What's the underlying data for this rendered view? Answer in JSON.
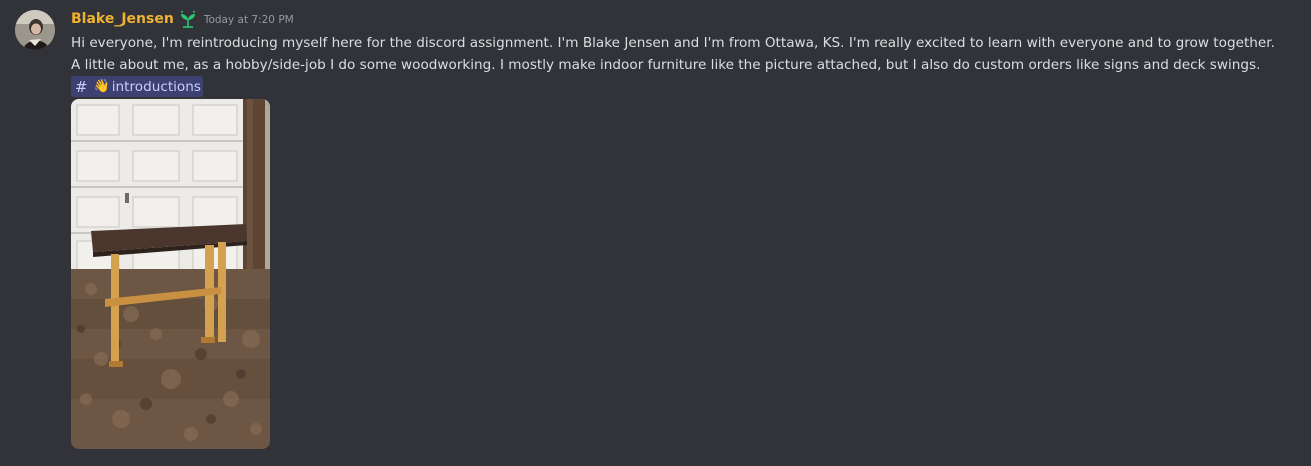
{
  "message": {
    "author": "Blake_Jensen",
    "timestamp": "Today at 7:20 PM",
    "lines": [
      "Hi everyone, I'm reintroducing myself here for the discord assignment. I'm Blake Jensen and I'm from Ottawa, KS. I'm really excited to learn with everyone and to grow together.",
      "A little about me, as a hobby/side-job I do some woodworking. I mostly make indoor furniture like the picture attached, but I also do custom orders like signs and deck swings."
    ],
    "channel_mention": {
      "prefix": "#",
      "emoji": "👋",
      "name": "introductions"
    }
  },
  "colors": {
    "background": "#313338",
    "username": "#f0b232",
    "text": "#dbdee1",
    "timestamp": "#949ba4",
    "mention_bg": "rgba(88,101,242,0.3)",
    "mention_text": "#c9cdfb",
    "role_icon": "#2dc770"
  },
  "icons": {
    "role": "sprout-icon",
    "avatar": "user-avatar"
  }
}
